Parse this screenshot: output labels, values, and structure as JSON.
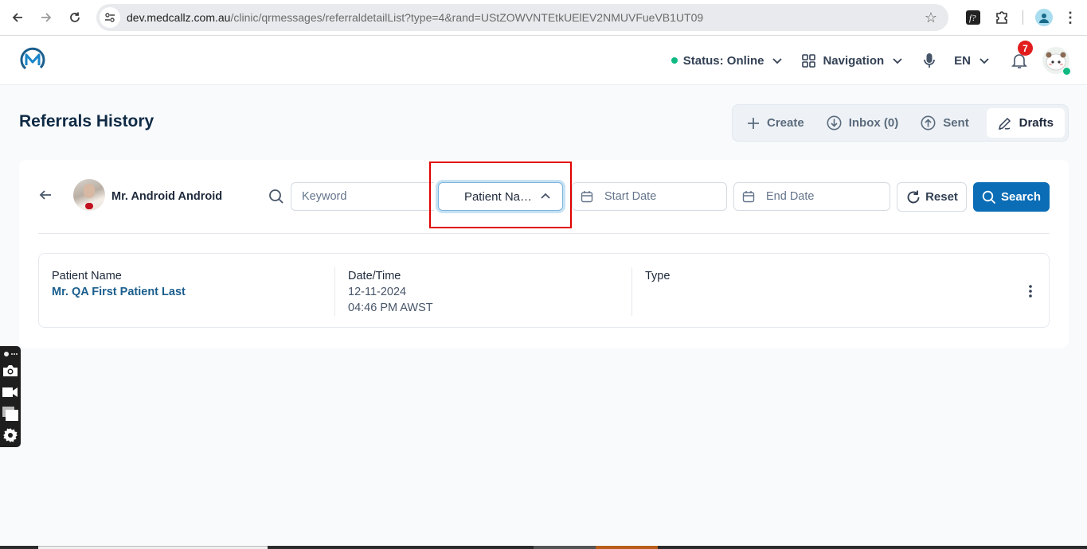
{
  "browser": {
    "url_host": "dev.medcallz.com.au",
    "url_path": "/clinic/qrmessages/referraldetailList?type=4&rand=UStZOWVNTEtkUElEV2NMUVFueVB1UT09",
    "icons": [
      "back-icon",
      "forward-icon",
      "reload-icon",
      "site-info-icon",
      "bookmark-star-icon",
      "extension-fontfinder-icon",
      "extensions-puzzle-icon",
      "profile-icon",
      "menu-kebab-icon"
    ]
  },
  "header": {
    "logo": "medcallz-logo",
    "status_label": "Status: Online",
    "status_color": "#10b981",
    "navigation_label": "Navigation",
    "language": "EN",
    "notification_count": "7",
    "notification_badge_color": "#e11d1d"
  },
  "page": {
    "title": "Referrals History",
    "tabs": [
      {
        "label": "Create",
        "icon": "plus-icon"
      },
      {
        "label": "Inbox (0)",
        "icon": "download-circle-icon"
      },
      {
        "label": "Sent",
        "icon": "upload-circle-icon"
      },
      {
        "label": "Drafts",
        "icon": "pen-icon",
        "active": true
      }
    ]
  },
  "filters": {
    "user_name": "Mr. Android Android",
    "keyword_placeholder": "Keyword",
    "sort_selected": "Patient Na…",
    "start_date_placeholder": "Start Date",
    "end_date_placeholder": "End Date",
    "reset_label": "Reset",
    "search_label": "Search",
    "accent_color": "#0a6db6"
  },
  "records": [
    {
      "patient_name_label": "Patient Name",
      "patient_name": "Mr. QA First Patient Last",
      "datetime_label": "Date/Time",
      "date": "12-11-2024",
      "time": "04:46 PM AWST",
      "type_label": "Type",
      "type": ""
    }
  ]
}
